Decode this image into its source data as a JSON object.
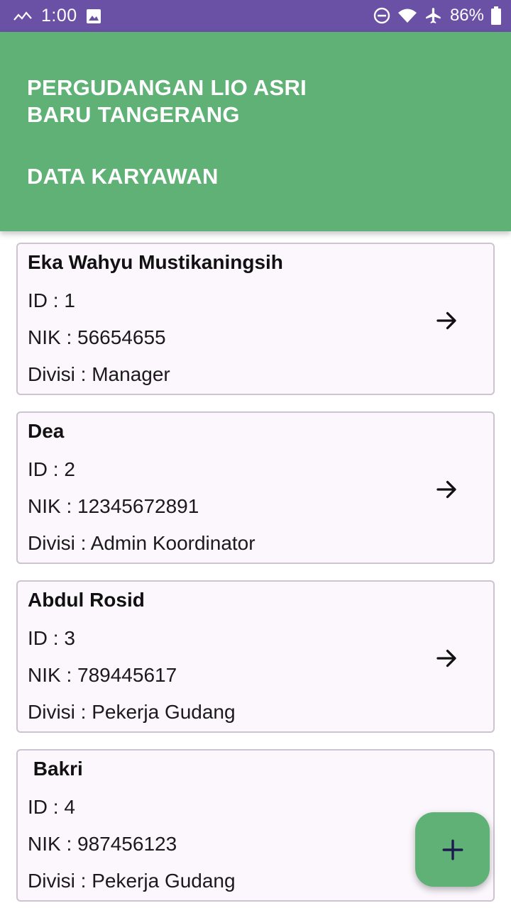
{
  "status_bar": {
    "time": "1:00",
    "battery": "86%",
    "icons": [
      "signal-icon",
      "image-icon",
      "dnd-icon",
      "wifi-icon",
      "airplane-icon",
      "battery-icon"
    ]
  },
  "header": {
    "title_line1": "PERGUDANGAN LIO ASRI",
    "title_line2": "BARU TANGERANG",
    "subtitle": "DATA KARYAWAN"
  },
  "employees": [
    {
      "name": "Eka Wahyu Mustikaningsih",
      "id": "ID : 1",
      "nik": "NIK : 56654655",
      "divisi": "Divisi : Manager"
    },
    {
      "name": "Dea",
      "id": "ID : 2",
      "nik": "NIK : 12345672891",
      "divisi": "Divisi : Admin Koordinator"
    },
    {
      "name": "Abdul Rosid",
      "id": "ID : 3",
      "nik": "NIK : 789445617",
      "divisi": "Divisi : Pekerja Gudang"
    },
    {
      "name": " Bakri",
      "id": "ID : 4",
      "nik": "NIK : 987456123",
      "divisi": "Divisi : Pekerja Gudang"
    }
  ],
  "colors": {
    "status_bar": "#6a51a6",
    "app_bar": "#5fb176",
    "card_bg": "#fcf7fd",
    "card_border": "#cdc3d2",
    "fab_icon": "#1d1b4e"
  },
  "fab": {
    "icon": "plus-icon"
  }
}
